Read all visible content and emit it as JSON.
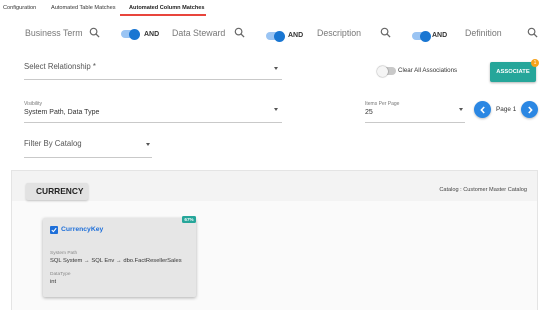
{
  "tabs": [
    {
      "label": "Configuration"
    },
    {
      "label": "Automated Table Matches"
    },
    {
      "label": "Automated Column Matches",
      "active": true
    }
  ],
  "filters": {
    "fields": [
      {
        "label": "Business Term"
      },
      {
        "label": "Data Steward"
      },
      {
        "label": "Description"
      },
      {
        "label": "Definition"
      }
    ],
    "and_label": "AND"
  },
  "relationship": {
    "placeholder": "Select Relationship *"
  },
  "clear_all": {
    "label": "Clear All Associations",
    "enabled": false
  },
  "associate": {
    "label": "ASSOCIATE",
    "badge": "1"
  },
  "visibility": {
    "label": "Visibility",
    "value": "System Path, Data Type"
  },
  "items_per_page": {
    "label": "Items Per Page",
    "value": "25"
  },
  "pagination": {
    "label": "Page 1"
  },
  "filter_catalog": {
    "placeholder": "Filter By Catalog"
  },
  "table_group": {
    "name": "CURRENCY",
    "catalog": "Catalog : Customer Master Catalog"
  },
  "match_card": {
    "badge": "67%",
    "column_name": "CurrencyKey",
    "checked": true,
    "system_path_label": "System Path",
    "system_path": "SQL System → SQL Env → dbo.FactResellerSales",
    "datatype_label": "DataType",
    "datatype": "int"
  },
  "colors": {
    "accent_blue": "#1976d2",
    "teal": "#26a69a",
    "tab_underline": "#e8453c",
    "badge_orange": "#f7a21a"
  },
  "icons": [
    "search-icon",
    "chevron-left-icon",
    "chevron-right-icon",
    "checkbox-checked-icon",
    "dropdown-caret-icon"
  ]
}
